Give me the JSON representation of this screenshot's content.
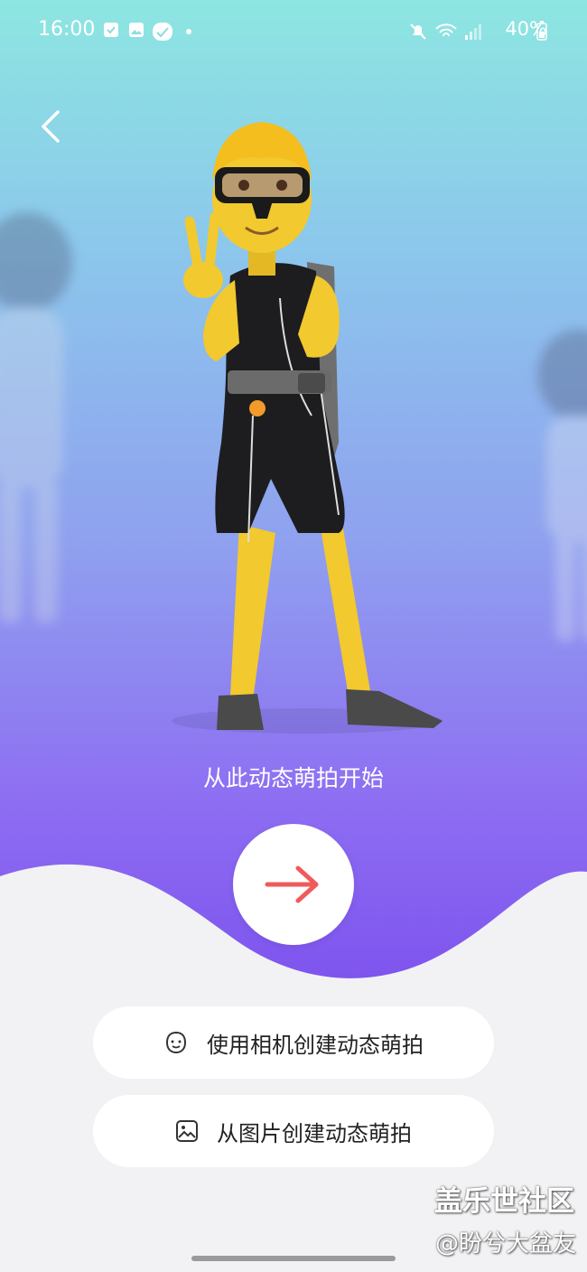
{
  "status_bar": {
    "time": "16:00",
    "battery": "40%",
    "icons": [
      "check-notification-icon",
      "gallery-notification-icon",
      "app-notification-icon",
      "dot-icon",
      "mute-icon",
      "wifi-icon",
      "signal-icon",
      "battery-icon"
    ]
  },
  "main": {
    "caption": "从此动态萌拍开始",
    "next_button_icon": "arrow-right-icon",
    "arrow_color": "#f05a5a"
  },
  "options": {
    "camera_label": "使用相机创建动态萌拍",
    "image_label": "从图片创建动态萌拍"
  },
  "watermark": {
    "line1": "盖乐世社区",
    "line2": "@盼兮大盆友"
  },
  "colors": {
    "gradient_top": "#8de6e1",
    "gradient_bottom": "#7d52ee",
    "skin": "#f2c92e",
    "suit": "#1d1d1f"
  }
}
